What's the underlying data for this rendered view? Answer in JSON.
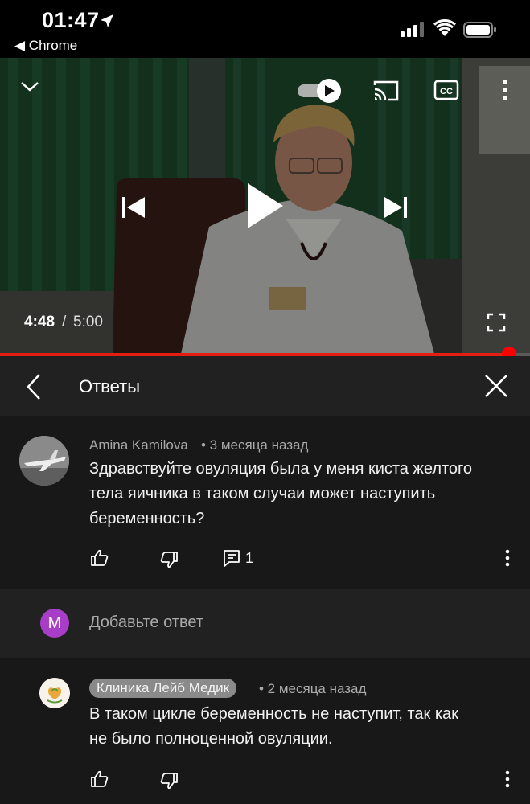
{
  "status_bar": {
    "time": "01:47",
    "back_app": "◀ Chrome"
  },
  "video": {
    "current_time": "4:48",
    "separator": "/",
    "duration": "5:00",
    "progress": 0.96
  },
  "replies": {
    "title": "Ответы"
  },
  "main_comment": {
    "author": "Amina Kamilova",
    "age": "• 3 месяца назад",
    "text_lines": [
      "Здравствуйте овуляция была у меня киста желтого",
      "тела яичника в таком случаи может наступить",
      "беременность?"
    ],
    "reply_count": "1"
  },
  "add_reply": {
    "avatar_letter": "M",
    "placeholder": "Добавьте ответ"
  },
  "reply": {
    "author": "Клиника Лейб Медик",
    "age": "• 2 месяца назад",
    "text_lines": [
      "В таком цикле  беременность не наступит, так как",
      "не было полноценной овуляции."
    ]
  },
  "colors": {
    "accent": "#ff0000",
    "avatar_m": "#a83ec7"
  }
}
